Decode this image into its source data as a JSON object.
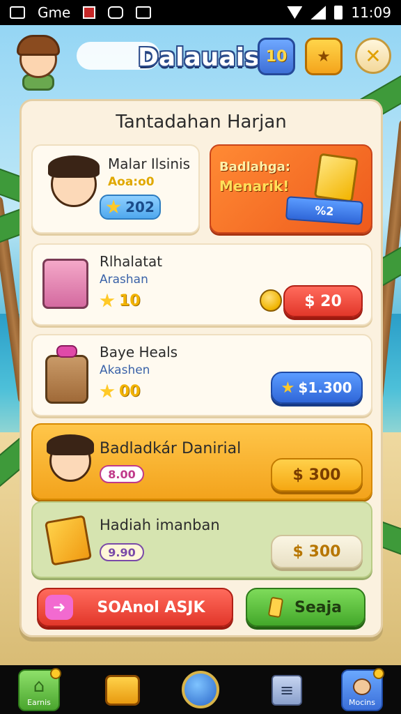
{
  "status_bar": {
    "app_label": "Gme",
    "time": "11:09"
  },
  "header": {
    "title": "Dalauais",
    "level_label": "10"
  },
  "panel": {
    "title": "Tantadahan Harjan"
  },
  "cards": [
    {
      "title": "Malar Ilsinis",
      "subtitle": "Aoa:o0",
      "stat": "202"
    },
    {
      "promo_line1": "Badlahga:",
      "promo_line2": "Menarik!",
      "promo_tag": "%2"
    },
    {
      "title": "Rlhalatat",
      "subtitle": "Arashan",
      "stat": "10",
      "price": "$ 20"
    },
    {
      "title": "Baye Heals",
      "subtitle": "Akashen",
      "stat": "00",
      "price": "$1.300"
    },
    {
      "title": "Badladkár Danirial",
      "stat": "8.00",
      "price": "$ 300"
    },
    {
      "title": "Hadiah imanban",
      "stat": "9.90",
      "price": "$ 300"
    }
  ],
  "actions": {
    "primary_label": "SOAnol ASJK",
    "secondary_label": "Seaja"
  },
  "bottom_nav": [
    {
      "label": "Earnis",
      "icon": "home-icon"
    },
    {
      "label": "",
      "icon": "chest-icon"
    },
    {
      "label": "",
      "icon": "globe-icon"
    },
    {
      "label": "",
      "icon": "menu-icon"
    },
    {
      "label": "Mocins",
      "icon": "pet-icon"
    }
  ],
  "colors": {
    "panel_bg": "#fbf1df",
    "title_outline": "#2a4a8a",
    "red_button": "#e2372a",
    "blue_button": "#2f66d8",
    "orange_button": "#f5a712",
    "green_button": "#5cbf3a",
    "promo_orange": "#f06a22"
  }
}
